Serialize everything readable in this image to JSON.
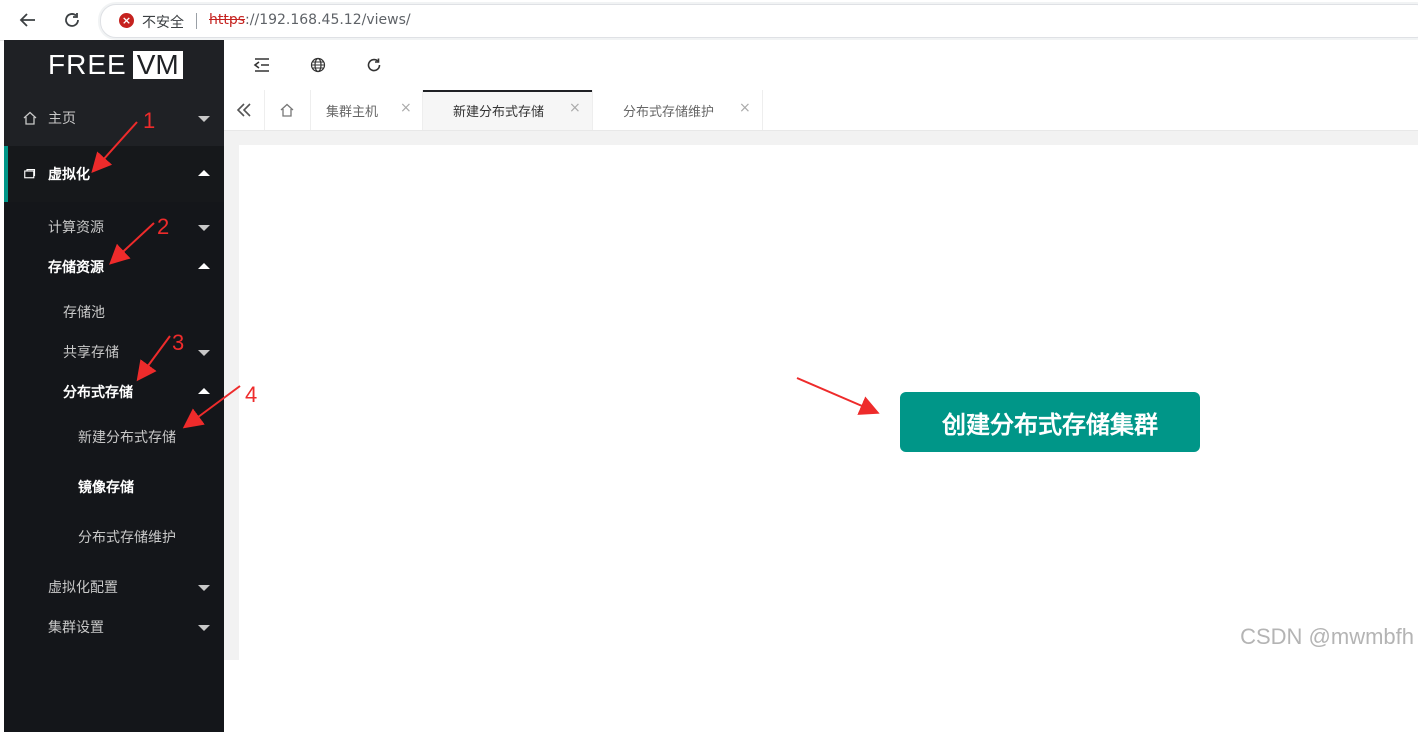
{
  "browser": {
    "security_label": "不安全",
    "url_scheme": "https",
    "url_rest": "://192.168.45.12/views/"
  },
  "sidebar": {
    "logo_left": "FREE",
    "logo_right": "VM",
    "items": [
      {
        "label": "主页",
        "icon": "home-icon",
        "caret": "down"
      },
      {
        "label": "虚拟化",
        "icon": "server-icon",
        "caret": "up"
      },
      {
        "label": "计算资源",
        "caret": "down"
      },
      {
        "label": "存储资源",
        "caret": "up"
      },
      {
        "label": "存储池"
      },
      {
        "label": "共享存储",
        "caret": "down"
      },
      {
        "label": "分布式存储",
        "caret": "up"
      },
      {
        "label": "新建分布式存储"
      },
      {
        "label": "镜像存储"
      },
      {
        "label": "分布式存储维护"
      },
      {
        "label": "虚拟化配置",
        "caret": "down"
      },
      {
        "label": "集群设置",
        "caret": "down"
      }
    ]
  },
  "toolbar": {
    "icons": [
      "menu-fold-icon",
      "globe-icon",
      "refresh-icon"
    ]
  },
  "tabs": [
    {
      "label": "集群主机",
      "close": "×"
    },
    {
      "label": "新建分布式存储",
      "close": "×",
      "active": true
    },
    {
      "label": "分布式存储维护",
      "close": "×"
    }
  ],
  "main": {
    "create_button": "创建分布式存储集群"
  },
  "annotations": [
    "1",
    "2",
    "3",
    "4"
  ],
  "watermark": "CSDN @mwmbfh",
  "colors": {
    "accent": "#009688",
    "sidebar": "#1f2125",
    "annotation": "#ee2b2b"
  }
}
